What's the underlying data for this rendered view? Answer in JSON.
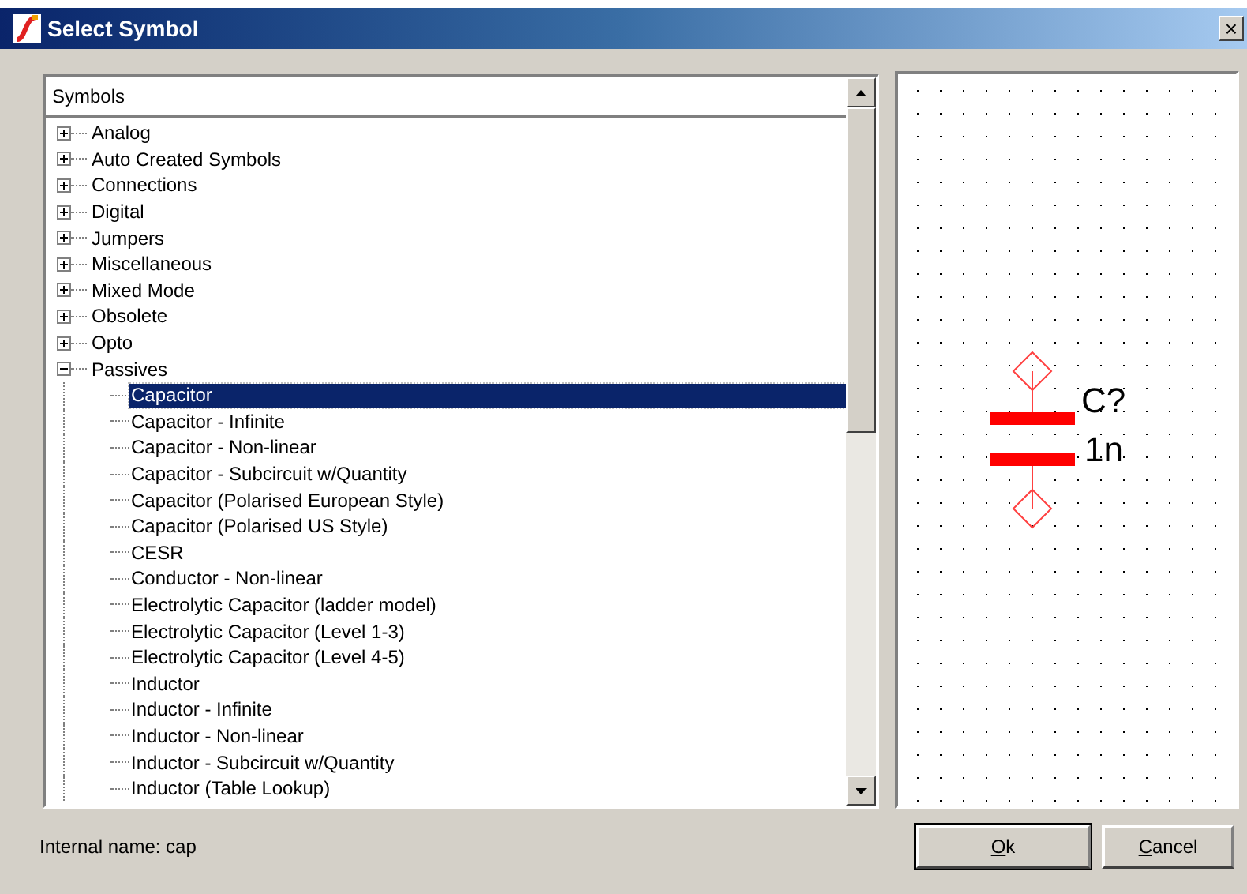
{
  "window": {
    "title": "Select Symbol",
    "close": "×"
  },
  "tree": {
    "header": "Symbols",
    "items": [
      {
        "label": "Analog",
        "expanded": false
      },
      {
        "label": "Auto Created Symbols",
        "expanded": false
      },
      {
        "label": "Connections",
        "expanded": false
      },
      {
        "label": "Digital",
        "expanded": false
      },
      {
        "label": "Jumpers",
        "expanded": false
      },
      {
        "label": "Miscellaneous",
        "expanded": false
      },
      {
        "label": "Mixed Mode",
        "expanded": false
      },
      {
        "label": "Obsolete",
        "expanded": false
      },
      {
        "label": "Opto",
        "expanded": false
      },
      {
        "label": "Passives",
        "expanded": true,
        "children": [
          {
            "label": "Capacitor",
            "selected": true
          },
          {
            "label": "Capacitor - Infinite",
            "selected": false
          },
          {
            "label": "Capacitor - Non-linear",
            "selected": false
          },
          {
            "label": "Capacitor - Subcircuit w/Quantity",
            "selected": false
          },
          {
            "label": "Capacitor (Polarised European Style)",
            "selected": false
          },
          {
            "label": "Capacitor (Polarised US Style)",
            "selected": false
          },
          {
            "label": "CESR",
            "selected": false
          },
          {
            "label": "Conductor - Non-linear",
            "selected": false
          },
          {
            "label": "Electrolytic Capacitor (ladder model)",
            "selected": false
          },
          {
            "label": "Electrolytic Capacitor (Level 1-3)",
            "selected": false
          },
          {
            "label": "Electrolytic Capacitor (Level 4-5)",
            "selected": false
          },
          {
            "label": "Inductor",
            "selected": false
          },
          {
            "label": "Inductor - Infinite",
            "selected": false
          },
          {
            "label": "Inductor - Non-linear",
            "selected": false
          },
          {
            "label": "Inductor - Subcircuit w/Quantity",
            "selected": false
          },
          {
            "label": "Inductor (Table Lookup)",
            "selected": false
          }
        ]
      }
    ]
  },
  "preview": {
    "ref": "C?",
    "value": "1n"
  },
  "internal_name": "Internal name: cap",
  "buttons": [
    "Ok",
    "Cancel"
  ]
}
